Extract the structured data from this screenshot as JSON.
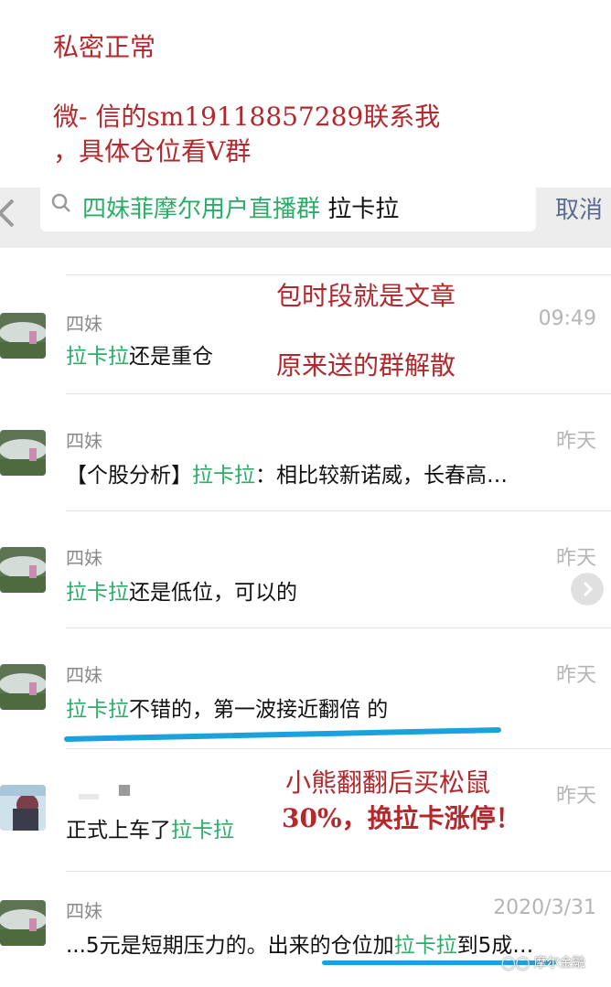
{
  "overlay": {
    "line1": "私密正常",
    "line2": "微- 信的sm19118857289联系我",
    "line3": "，具体仓位看V群",
    "note_a1": "包时段就是文章",
    "note_a2": "原来送的群解散",
    "note_b1": "小熊翻翻后买松鼠",
    "note_b2": "30%，换拉卡涨停！",
    "color": "#b3282d"
  },
  "search": {
    "group_name": "四妹菲摩尔用户直播群",
    "keyword": "拉卡拉",
    "cancel_label": "取消",
    "icons": [
      "back-chevron-icon",
      "search-icon",
      "clear-icon"
    ]
  },
  "results": [
    {
      "name": "四妹",
      "time": "09:49",
      "hl": "拉卡拉",
      "post": "还是重仓"
    },
    {
      "name": "四妹",
      "time": "昨天",
      "pre": "【个股分析】",
      "hl": "拉卡拉",
      "post": "：相比较新诺威，长春高…"
    },
    {
      "name": "四妹",
      "time": "昨天",
      "hl": "拉卡拉",
      "post": "还是低位，可以的"
    },
    {
      "name": "四妹",
      "time": "昨天",
      "hl": "拉卡拉",
      "post": "不错的，第一波接近翻倍 的"
    },
    {
      "name": "",
      "time": "昨天",
      "pre": "正式上车了",
      "hl": "拉卡拉"
    },
    {
      "name": "四妹",
      "time": "2020/3/31",
      "pre": "...5元是短期压力的。出来的仓位加",
      "hl": "拉卡拉",
      "post": "到5成…"
    }
  ],
  "highlight_color": "#2aae67",
  "underline_color": "#1ba2dc",
  "watermark": "摩尔金融"
}
